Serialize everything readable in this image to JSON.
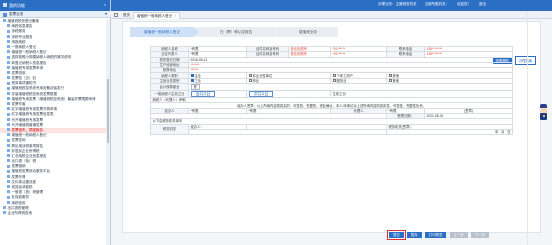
{
  "header": {
    "right_items": [
      "办理业务：主管税务机关",
      "当前所属机关：",
      "欢迎您！",
      "退出"
    ]
  },
  "left": {
    "title": "我的功能",
    "search_label": "发票业务",
    "tree": [
      "增值税税务登记备案",
      "纳税信息报告",
      "涉税服务",
      "涉税专业服务",
      "申报纳税",
      "一般纳税人登记",
      "增值税一般纳税人登记",
      "选择按照小规模纳税人纳税的情况说明",
      "转登记纳税人信息报告",
      "增值税专用发票申请",
      "发票领用",
      "发票验（交）旧",
      "税务事项通知书",
      "增值税税控系统专用设备初始发行",
      "存量增值税税控系统发票数据",
      "增值税专用发票（增值税税控系统）最高开票限额申请",
      "发票作废",
      "红字增值税专用发票开具申请",
      "红字增值税专用发票信息表",
      "代开增值税专用发票",
      "代开增值税普通发票",
      "发票遗失、损毁报告",
      "增值税一般纳税人登记",
      "发票查询",
      "跨区域涉税事项报告",
      "非居民企业所得税",
      "汇总纳税企业信息报告",
      "出口退（免）税",
      "发票缴销",
      "增值税发票综合服务平台",
      "发票开具",
      "文化事业建设费",
      "成品油消费税",
      "一般退（抵）税管理",
      "社保费服务",
      "纳税信用",
      "出口退税管理",
      "企业所得税查询"
    ],
    "selected_index": 21
  },
  "tabs": [
    {
      "label": "首页"
    },
    {
      "label": "增值税一般纳税人登记"
    }
  ],
  "steps": [
    "增值税一般纳税人登记",
    "归（票）种认定报告",
    "增值税业务"
  ],
  "right_buttons": [
    "查看帮助",
    "办理指南"
  ],
  "form": {
    "rows": [
      [
        "纳税人名称",
        "*有限",
        "证件名称及号码",
        "营业执照号",
        "*91******",
        "联系电话",
        "138********"
      ],
      [
        "法定代表人",
        "*有限",
        "证件名称及号码",
        "营业执照号",
        "*91******",
        "联系电话",
        "138********"
      ],
      [
        "税务登记日期",
        "2018-08-12",
        "",
        "",
        "",
        "",
        ""
      ],
      [
        "生产经营地址",
        "*******",
        "",
        "",
        "",
        "",
        ""
      ],
      [
        "核算地址",
        "******",
        "",
        "",
        "",
        "",
        ""
      ]
    ],
    "taxpayer_category_label": "纳税人类别",
    "taxpayer_category_opts": [
      "企业",
      "非企业性单位",
      "个体工商户",
      "其他"
    ],
    "main_business_label": "主营业务类别",
    "main_business_opts": [
      "工业",
      "商业",
      "服务业",
      "其他"
    ],
    "accounting_label": "会计核算健全",
    "accounting_value": "是",
    "effective_label": "一般纳税人生效之日",
    "effective_opts": [
      "当月1日",
      "次月1日"
    ],
    "effective_suffix": "生效之日：",
    "declare_heading": "纳税人（代理人）声明",
    "declare_text": "经办人签章：以上所填内容是真实的、可靠的、完整的。谨此确认：本人/本单位对上述所填内容的真实性、可靠性、完整性负责。",
    "agent_label": "经办人",
    "agent_value": "*有限",
    "agent_idtype": "*有限",
    "agent_phone_label": "代理人",
    "agent_phone_value": "*有限",
    "seal_label": "(签章)",
    "date_label": "受理日期：",
    "date_value": "2022-08-31",
    "tax_office_heading": "以下由税务机关填写",
    "receiver_label": "税务机关",
    "handler_label": "经办人：",
    "reviewer_label": "税务机关(签章)",
    "ymd": [
      "年",
      "月",
      "日"
    ]
  },
  "buttons": {
    "submit": "提交",
    "save": "暂存",
    "print": "打印预览",
    "prev": "上一步",
    "next": "下一步"
  }
}
